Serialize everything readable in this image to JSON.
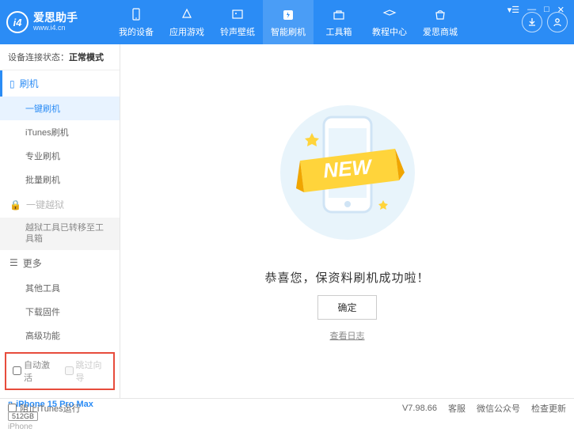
{
  "brand": {
    "title": "爱思助手",
    "url": "www.i4.cn"
  },
  "nav": {
    "items": [
      {
        "label": "我的设备"
      },
      {
        "label": "应用游戏"
      },
      {
        "label": "铃声壁纸"
      },
      {
        "label": "智能刷机"
      },
      {
        "label": "工具箱"
      },
      {
        "label": "教程中心"
      },
      {
        "label": "爱思商城"
      }
    ]
  },
  "sidebar": {
    "status_label": "设备连接状态：",
    "status_value": "正常模式",
    "flash_section": "刷机",
    "flash_items": [
      "一键刷机",
      "iTunes刷机",
      "专业刷机",
      "批量刷机"
    ],
    "jailbreak_section": "一键越狱",
    "jailbreak_note": "越狱工具已转移至工具箱",
    "more_section": "更多",
    "more_items": [
      "其他工具",
      "下载固件",
      "高级功能"
    ],
    "checkbox1": "自动激活",
    "checkbox2": "跳过向导",
    "device_name": "iPhone 15 Pro Max",
    "device_storage": "512GB",
    "device_type": "iPhone"
  },
  "main": {
    "new_badge": "NEW",
    "success_msg": "恭喜您，保资料刷机成功啦！",
    "ok_btn": "确定",
    "log_link": "查看日志"
  },
  "footer": {
    "block_itunes": "阻止iTunes运行",
    "version": "V7.98.66",
    "links": [
      "客服",
      "微信公众号",
      "检查更新"
    ]
  }
}
